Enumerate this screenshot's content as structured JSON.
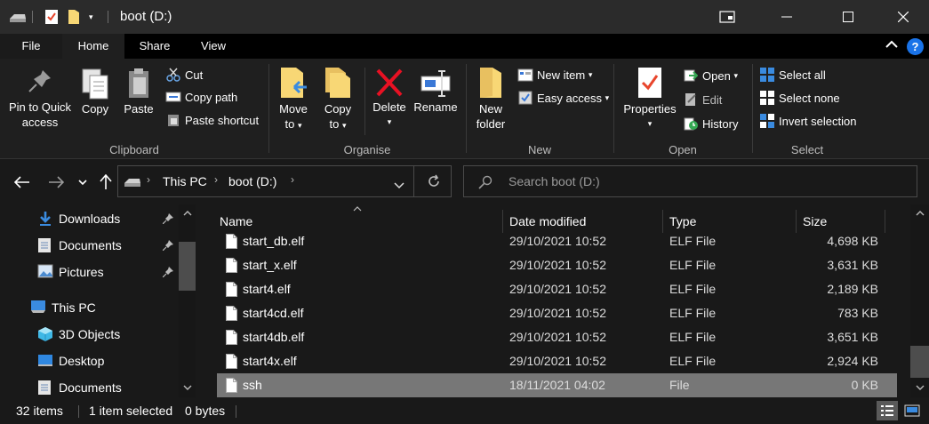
{
  "window": {
    "title": "boot (D:)",
    "colors": {
      "titlebar": "#2b2b2b",
      "ribbon": "#1f1f1f",
      "background": "#191919",
      "selected_row": "#777777",
      "delete_red": "#e81123",
      "folder_yellow": "#f8d775",
      "help_blue": "#1a73e8"
    }
  },
  "tabs": [
    {
      "label": "File"
    },
    {
      "label": "Home",
      "active": true
    },
    {
      "label": "Share"
    },
    {
      "label": "View"
    }
  ],
  "ribbon": {
    "clipboard": {
      "label": "Clipboard",
      "pin_label_1": "Pin to Quick",
      "pin_label_2": "access",
      "copy_label": "Copy",
      "paste_label": "Paste",
      "cut_label": "Cut",
      "copy_path_label": "Copy path",
      "paste_shortcut_label": "Paste shortcut"
    },
    "organise": {
      "label": "Organise",
      "move_to_1": "Move",
      "move_to_2": "to",
      "copy_to_1": "Copy",
      "copy_to_2": "to",
      "delete_label": "Delete",
      "rename_label": "Rename"
    },
    "new": {
      "label": "New",
      "new_folder_1": "New",
      "new_folder_2": "folder",
      "new_item_label": "New item",
      "easy_access_label": "Easy access"
    },
    "open": {
      "label": "Open",
      "properties_label": "Properties",
      "open_label": "Open",
      "edit_label": "Edit",
      "history_label": "History"
    },
    "select": {
      "label": "Select",
      "select_all_label": "Select all",
      "select_none_label": "Select none",
      "invert_selection_label": "Invert selection"
    }
  },
  "address": {
    "crumbs": [
      "This PC",
      "boot (D:)"
    ],
    "search_placeholder": "Search boot (D:)"
  },
  "nav_pane": {
    "items": [
      {
        "label": "Downloads",
        "icon": "download-arrow-icon",
        "pinned": true
      },
      {
        "label": "Documents",
        "icon": "documents-icon",
        "pinned": true
      },
      {
        "label": "Pictures",
        "icon": "pictures-icon",
        "pinned": true
      },
      {
        "label": "This PC",
        "icon": "computer-icon"
      },
      {
        "label": "3D Objects",
        "icon": "cube-icon"
      },
      {
        "label": "Desktop",
        "icon": "desktop-icon"
      },
      {
        "label": "Documents",
        "icon": "documents-icon"
      }
    ]
  },
  "file_list": {
    "columns": [
      "Name",
      "Date modified",
      "Type",
      "Size"
    ],
    "rows": [
      {
        "name": "start_db.elf",
        "date": "29/10/2021 10:52",
        "type": "ELF File",
        "size": "4,698 KB"
      },
      {
        "name": "start_x.elf",
        "date": "29/10/2021 10:52",
        "type": "ELF File",
        "size": "3,631 KB"
      },
      {
        "name": "start4.elf",
        "date": "29/10/2021 10:52",
        "type": "ELF File",
        "size": "2,189 KB"
      },
      {
        "name": "start4cd.elf",
        "date": "29/10/2021 10:52",
        "type": "ELF File",
        "size": "783 KB"
      },
      {
        "name": "start4db.elf",
        "date": "29/10/2021 10:52",
        "type": "ELF File",
        "size": "3,651 KB"
      },
      {
        "name": "start4x.elf",
        "date": "29/10/2021 10:52",
        "type": "ELF File",
        "size": "2,924 KB"
      },
      {
        "name": "ssh",
        "date": "18/11/2021 04:02",
        "type": "File",
        "size": "0 KB",
        "selected": true
      }
    ]
  },
  "status": {
    "item_count": "32 items",
    "selection": "1 item selected",
    "selection_size": "0 bytes"
  }
}
